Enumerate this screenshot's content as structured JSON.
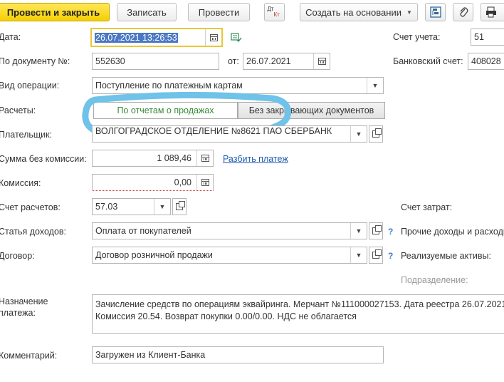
{
  "toolbar": {
    "post_and_close": "Провести и закрыть",
    "save": "Записать",
    "post": "Провести",
    "dt_kt": {
      "dt": "Дт",
      "kt": "Кт"
    },
    "create_based": "Создать на основании"
  },
  "form": {
    "date": {
      "label": "Дата:",
      "value": "26.07.2021 13:26:53"
    },
    "doc_number": {
      "label": "По документу №:",
      "value": "552630"
    },
    "from": {
      "label": "от:",
      "value": "26.07.2021"
    },
    "operation": {
      "label": "Вид операции:",
      "value": "Поступление по платежным картам"
    },
    "settlements": {
      "label": "Расчеты:",
      "option_sales_reports": "По отчетам о продажах",
      "option_no_docs": "Без закрывающих документов"
    },
    "payer": {
      "label": "Плательщик:",
      "value": "ВОЛГОГРАДСКОЕ ОТДЕЛЕНИЕ №8621 ПАО СБЕРБАНК"
    },
    "amount": {
      "label": "Сумма без комиссии:",
      "value": "1 089,46",
      "split_link": "Разбить платеж"
    },
    "commission": {
      "label": "Комиссия:",
      "value": "0,00"
    },
    "settlement_account": {
      "label": "Счет расчетов:",
      "value": "57.03"
    },
    "income_item": {
      "label": "Статья доходов:",
      "value": "Оплата от покупателей"
    },
    "contract": {
      "label": "Договор:",
      "value": "Договор розничной продажи"
    },
    "purpose": {
      "label_line1": "Назначение",
      "label_line2": "платежа:",
      "value": "Зачисление средств по операциям эквайринга. Мерчант №111000027153. Дата реестра 26.07.2021. Комиссия 20.54. Возврат покупки 0.00/0.00. НДС не облагается"
    },
    "comment": {
      "label": "Комментарий:",
      "value": "Загружен из Клиент-Банка"
    }
  },
  "right_panel": {
    "account": {
      "label": "Счет учета:",
      "value": "51"
    },
    "bank_account": {
      "label": "Банковский счет:",
      "value": "408028"
    },
    "cost_account": {
      "label": "Счет затрат:"
    },
    "other_income": {
      "label": "Прочие доходы и расходы"
    },
    "sold_assets": {
      "label": "Реализуемые активы:"
    },
    "department": {
      "label": "Подразделение:"
    }
  },
  "question_mark": "?",
  "colors": {
    "primary_button": "#f5cf00",
    "highlight_ring": "#6fc2e8",
    "link": "#1d5ab0",
    "selected_toggle_text": "#3a8a3a"
  }
}
